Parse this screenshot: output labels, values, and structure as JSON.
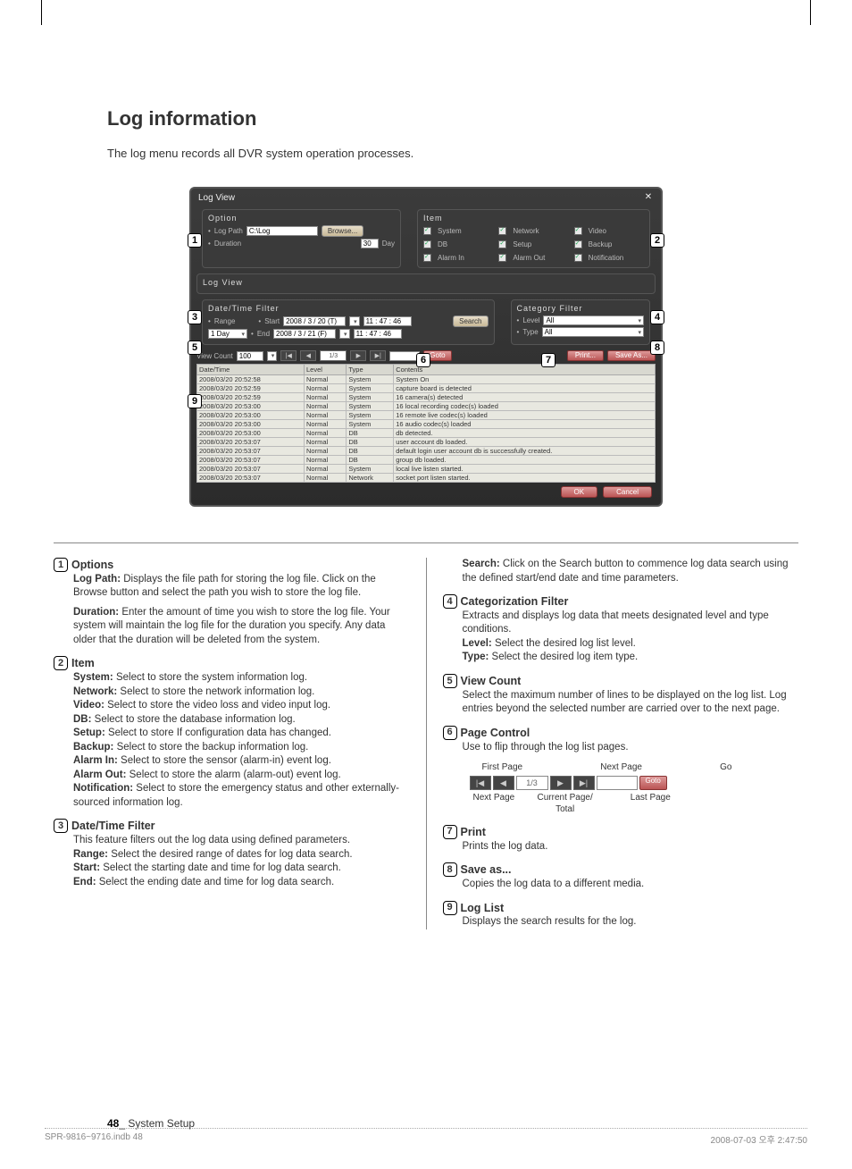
{
  "page": {
    "title": "Log information",
    "intro": "The log menu records all DVR system operation processes.",
    "number": "48",
    "section": "System Setup",
    "footer_left": "SPR-9816~9716.indb   48",
    "footer_right": "2008-07-03   오후 2:47:50"
  },
  "window": {
    "title": "Log View",
    "option_title": "Option",
    "item_title": "Item",
    "logview_title": "Log View",
    "log_path_label": "Log Path",
    "log_path_value": "C:\\Log",
    "browse": "Browse...",
    "duration_label": "Duration",
    "duration_value": "30",
    "duration_unit": "Day",
    "items": [
      "System",
      "Network",
      "Video",
      "DB",
      "Setup",
      "Backup",
      "Alarm In",
      "Alarm Out",
      "Notification"
    ],
    "dt_title": "Date/Time Filter",
    "range_label": "Range",
    "range_value": "1 Day",
    "start_label": "Start",
    "end_label": "End",
    "date_start": "2008 / 3 / 20 (T)",
    "date_end": "2008 / 3 / 21 (F)",
    "time_start": "11 : 47 : 46",
    "time_end": "11 : 47 : 46",
    "search": "Search",
    "cat_title": "Category Filter",
    "level_label": "Level",
    "type_label": "Type",
    "level_value": "All",
    "type_value": "All",
    "view_count_label": "View Count",
    "view_count_value": "100",
    "cur_page": "1/3",
    "goto": "Goto",
    "print": "Print...",
    "saveas": "Save As...",
    "ok": "OK",
    "cancel": "Cancel",
    "headers": [
      "Date/Time",
      "Level",
      "Type",
      "Contents"
    ],
    "rows": [
      [
        "2008/03/20 20:52:58",
        "Normal",
        "System",
        "System On"
      ],
      [
        "2008/03/20 20:52:59",
        "Normal",
        "System",
        "capture board is detected"
      ],
      [
        "2008/03/20 20:52:59",
        "Normal",
        "System",
        "16 camera(s) detected"
      ],
      [
        "2008/03/20 20:53:00",
        "Normal",
        "System",
        "16 local recording codec(s) loaded"
      ],
      [
        "2008/03/20 20:53:00",
        "Normal",
        "System",
        "16 remote live codec(s) loaded"
      ],
      [
        "2008/03/20 20:53:00",
        "Normal",
        "System",
        "16 audio codec(s) loaded"
      ],
      [
        "2008/03/20 20:53:00",
        "Normal",
        "DB",
        "db detected."
      ],
      [
        "2008/03/20 20:53:07",
        "Normal",
        "DB",
        "user account db loaded."
      ],
      [
        "2008/03/20 20:53:07",
        "Normal",
        "DB",
        "default login user account db is successfully created."
      ],
      [
        "2008/03/20 20:53:07",
        "Normal",
        "DB",
        "group db loaded."
      ],
      [
        "2008/03/20 20:53:07",
        "Normal",
        "System",
        "local live listen started."
      ],
      [
        "2008/03/20 20:53:07",
        "Normal",
        "Network",
        "socket port listen started."
      ]
    ]
  },
  "desc": {
    "n1_title": "Options",
    "n1_logpath_k": "Log Path:",
    "n1_logpath_v": "Displays the file path for storing the log file. Click on the Browse button and select the path you wish to store the log file.",
    "n1_dur_k": "Duration:",
    "n1_dur_v": "Enter the amount of time you wish to store the log file. Your system will maintain the log file for the duration you specify. Any data older that the duration will be deleted from the system.",
    "n2_title": "Item",
    "n2_system_k": "System:",
    "n2_system_v": "Select to store the system information log.",
    "n2_network_k": "Network:",
    "n2_network_v": "Select to store the network information log.",
    "n2_video_k": "Video:",
    "n2_video_v": "Select to store the video loss and video input log.",
    "n2_db_k": "DB:",
    "n2_db_v": "Select to store the database information log.",
    "n2_setup_k": "Setup:",
    "n2_setup_v": "Select to store If configuration data has changed.",
    "n2_backup_k": "Backup:",
    "n2_backup_v": "Select to store the backup information log.",
    "n2_alarmin_k": "Alarm In:",
    "n2_alarmin_v": "Select to store the sensor (alarm-in) event log.",
    "n2_alarmout_k": "Alarm Out:",
    "n2_alarmout_v": "Select to store the alarm (alarm-out) event log.",
    "n2_notif_k": "Notification:",
    "n2_notif_v": "Select to store the emergency status and other externally-sourced information log.",
    "n3_title": "Date/Time Filter",
    "n3_body": "This feature filters out the log data using defined parameters.",
    "n3_range_k": "Range:",
    "n3_range_v": "Select the desired range of dates for log data search.",
    "n3_start_k": "Start:",
    "n3_start_v": "Select the starting date and time for log data search.",
    "n3_end_k": "End:",
    "n3_end_v": "Select the ending date and time for log data search.",
    "n3_search_k": "Search:",
    "n3_search_v": "Click on the Search button to commence log data search using the defined start/end date and time parameters.",
    "n4_title": "Categorization Filter",
    "n4_body": "Extracts and displays log data that meets designated level and type conditions.",
    "n4_level_k": "Level:",
    "n4_level_v": "Select the desired log list level.",
    "n4_type_k": "Type:",
    "n4_type_v": "Select the desired log item type.",
    "n5_title": "View Count",
    "n5_body": "Select the maximum number of lines to be displayed on the log list. Log entries beyond the selected number are carried over to the next page.",
    "n6_title": "Page Control",
    "n6_body": "Use to flip through the log list pages.",
    "pc_first": "First Page",
    "pc_nextpage": "Next Page",
    "pc_go": "Go",
    "pc_nextpage2": "Next Page",
    "pc_current": "Current Page/\nTotal",
    "pc_last": "Last Page",
    "pc_mid": "1/3",
    "pc_goto": "Goto",
    "n7_title": "Print",
    "n7_body": "Prints the log data.",
    "n8_title": "Save as...",
    "n8_body": "Copies the log data to a different media.",
    "n9_title": "Log List",
    "n9_body": "Displays the search results for the log."
  }
}
